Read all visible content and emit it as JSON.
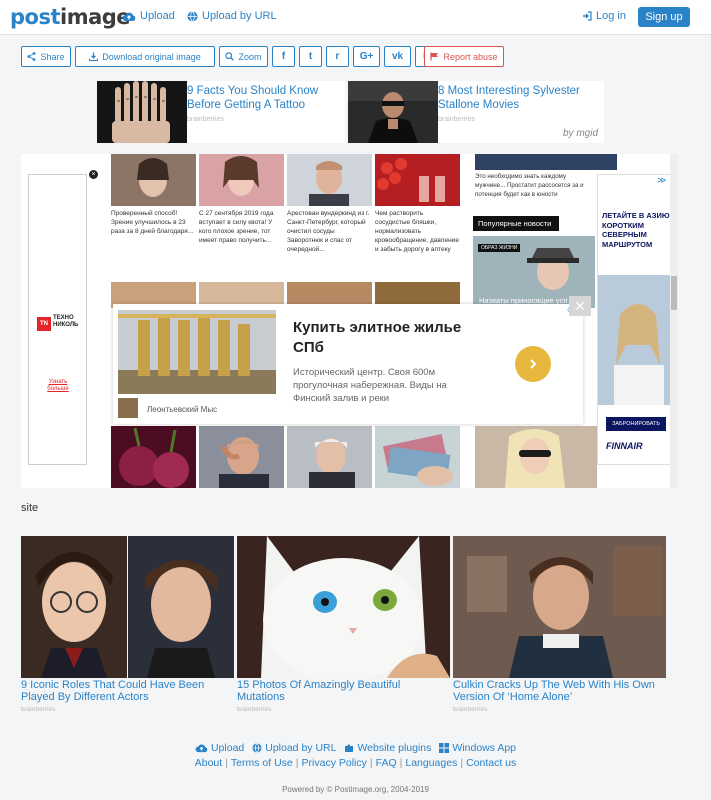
{
  "nav": {
    "brand_part1": "post",
    "brand_part2": "image",
    "upload": "Upload",
    "upload_url": "Upload by URL",
    "login": "Log in",
    "signup": "Sign up"
  },
  "toolbar": {
    "share": "Share",
    "download": "Download original image",
    "zoom": "Zoom",
    "facebook": "f",
    "twitter": "t",
    "reddit": "r",
    "google": "G+",
    "vk": "vk",
    "email": "✉",
    "report": "Report abuse"
  },
  "top_ads": [
    {
      "title": "9 Facts You Should Know Before Getting A Tattoo",
      "source": "brainberries"
    },
    {
      "title": "8 Most Interesting Sylvester Stallone Movies",
      "source": "brainberries"
    }
  ],
  "mgid_label": "by mgid",
  "ad_cards_row1": [
    "Проверенный способ! Зрение улучшилось в 23 раза за 8 дней благодаря...",
    "С 27 сентября 2019 года вступает в силу квота! У кого плохое зрение, тот имеет право получить...",
    "Арестован вундеркинд из г. Санкт-Петербург, который очистил сосуды Заворотнюк и спас от очередной...",
    "Чем растворить сосудистые бляшки, нормализовать кровообращение, давление и забыть дорогу в аптеку"
  ],
  "ad_right_text": "Это необходимо знать каждому мужчине... Простатит рассосется за и потенция будет как в юности",
  "ad_popular": "Популярные новости",
  "ad_popular_tag": "ОБРАЗ ЖИЗНИ",
  "ad_popular_caption": "Назваты приносящие усп",
  "left_banner": {
    "brand": "ТЕХНО НИКОЛЬ",
    "cta": "Узнать больше"
  },
  "right_banner": {
    "headline": "ЛЕТАЙТЕ В АЗИЮ КОРОТКИМ СЕВЕРНЫМ МАРШРУТОМ",
    "cta": "ЗАБРОНИРОВАТЬ",
    "brand": "FINNAIR"
  },
  "popup": {
    "title": "Купить элитное жилье СПб",
    "desc": "Исторический центр. Своя 600м прогулочная набережная. Виды на Финский залив и реки",
    "advertiser": "Леонтьевский Мыс"
  },
  "site_caption": "site",
  "bottom_ads": [
    {
      "title": "9 Iconic Roles That Could Have Been Played By Different Actors",
      "source": "brainberries"
    },
    {
      "title": "15 Photos Of Amazingly Beautiful Mutations",
      "source": "brainberries"
    },
    {
      "title": "Culkin Cracks Up The Web With His Own Version Of ‘Home Alone’",
      "source": "brainberries"
    }
  ],
  "footer": {
    "upload": "Upload",
    "upload_url": "Upload by URL",
    "plugins": "Website plugins",
    "windows": "Windows App",
    "about": "About",
    "terms": "Terms of Use",
    "privacy": "Privacy Policy",
    "faq": "FAQ",
    "languages": "Languages",
    "contact": "Contact us",
    "powered": "Powered by © Postimage.org, 2004-2019"
  },
  "colors": {
    "accent": "#2b83c7",
    "danger": "#d9534f",
    "background": "#f4f5f7"
  }
}
